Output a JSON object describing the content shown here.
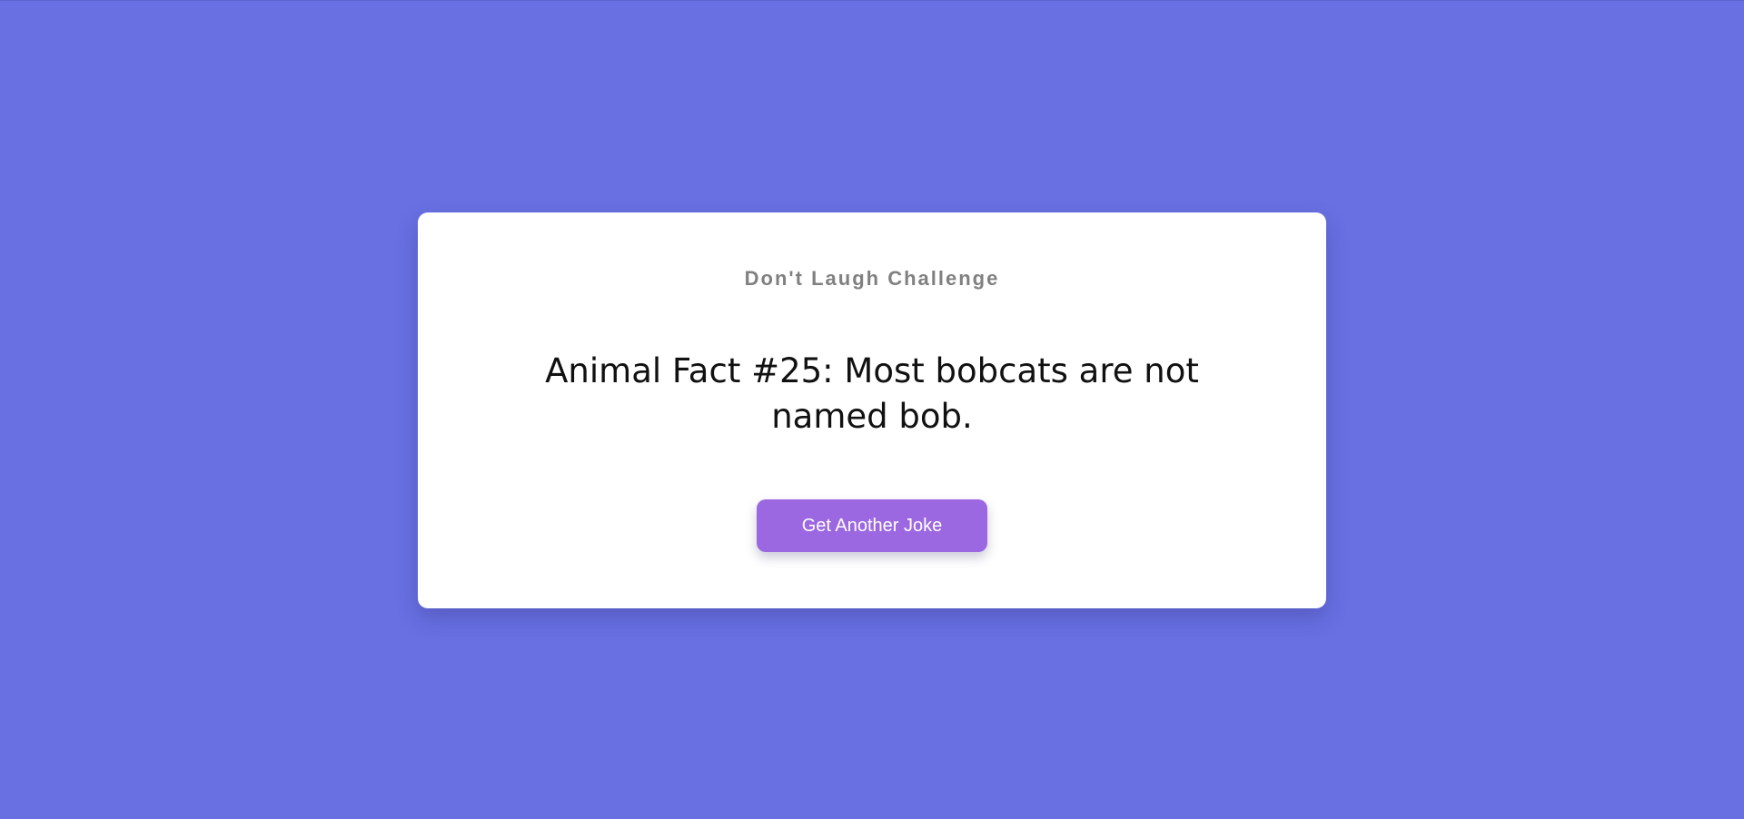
{
  "app": {
    "title": "Don't Laugh Challenge"
  },
  "joke": {
    "text": "Animal Fact #25: Most bobcats are not named bob."
  },
  "actions": {
    "next_joke_label": "Get Another Joke"
  },
  "colors": {
    "background": "#6870e2",
    "card": "#ffffff",
    "title": "#808080",
    "joke_text": "#111111",
    "button": "#9c68e1",
    "button_text": "#ffffff"
  }
}
